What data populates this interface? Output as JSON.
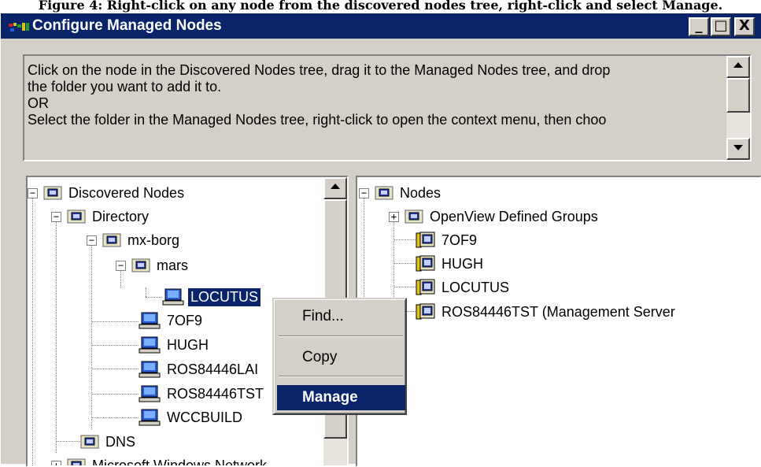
{
  "heading": "Figure 4: Right-click on any node from the discovered nodes tree, right-click and select Manage.",
  "window": {
    "title": "Configure Managed Nodes",
    "controls": {
      "minimize": "_",
      "maximize": "□",
      "close": "X"
    }
  },
  "instructions": {
    "lines": [
      "Click on the node in the Discovered Nodes tree, drag it to the Managed Nodes tree, and drop",
      "the folder you want to add it to.",
      "OR",
      "Select the folder in the Managed Nodes tree, right-click to open the context menu, then choo"
    ]
  },
  "discovered_tree": {
    "root": "Discovered Nodes",
    "directory": "Directory",
    "domain": "mx-borg",
    "folder": "mars",
    "selected_node": "LOCUTUS",
    "nodes": [
      "7OF9",
      "HUGH",
      "ROS84446LAI",
      "ROS84446TST",
      "WCCBUILD"
    ],
    "dns": "DNS",
    "partial": "Microsoft Windows Network"
  },
  "managed_tree": {
    "root": "Nodes",
    "group": "OpenView Defined Groups",
    "nodes": [
      "7OF9",
      "HUGH",
      "LOCUTUS",
      "ROS84446TST (Management Server"
    ]
  },
  "context_menu": {
    "find": "Find...",
    "copy": "Copy",
    "manage": "Manage"
  },
  "colors": {
    "face": "#d4d0c8",
    "titlebar": "#0a246a",
    "selection": "#0a246a"
  }
}
